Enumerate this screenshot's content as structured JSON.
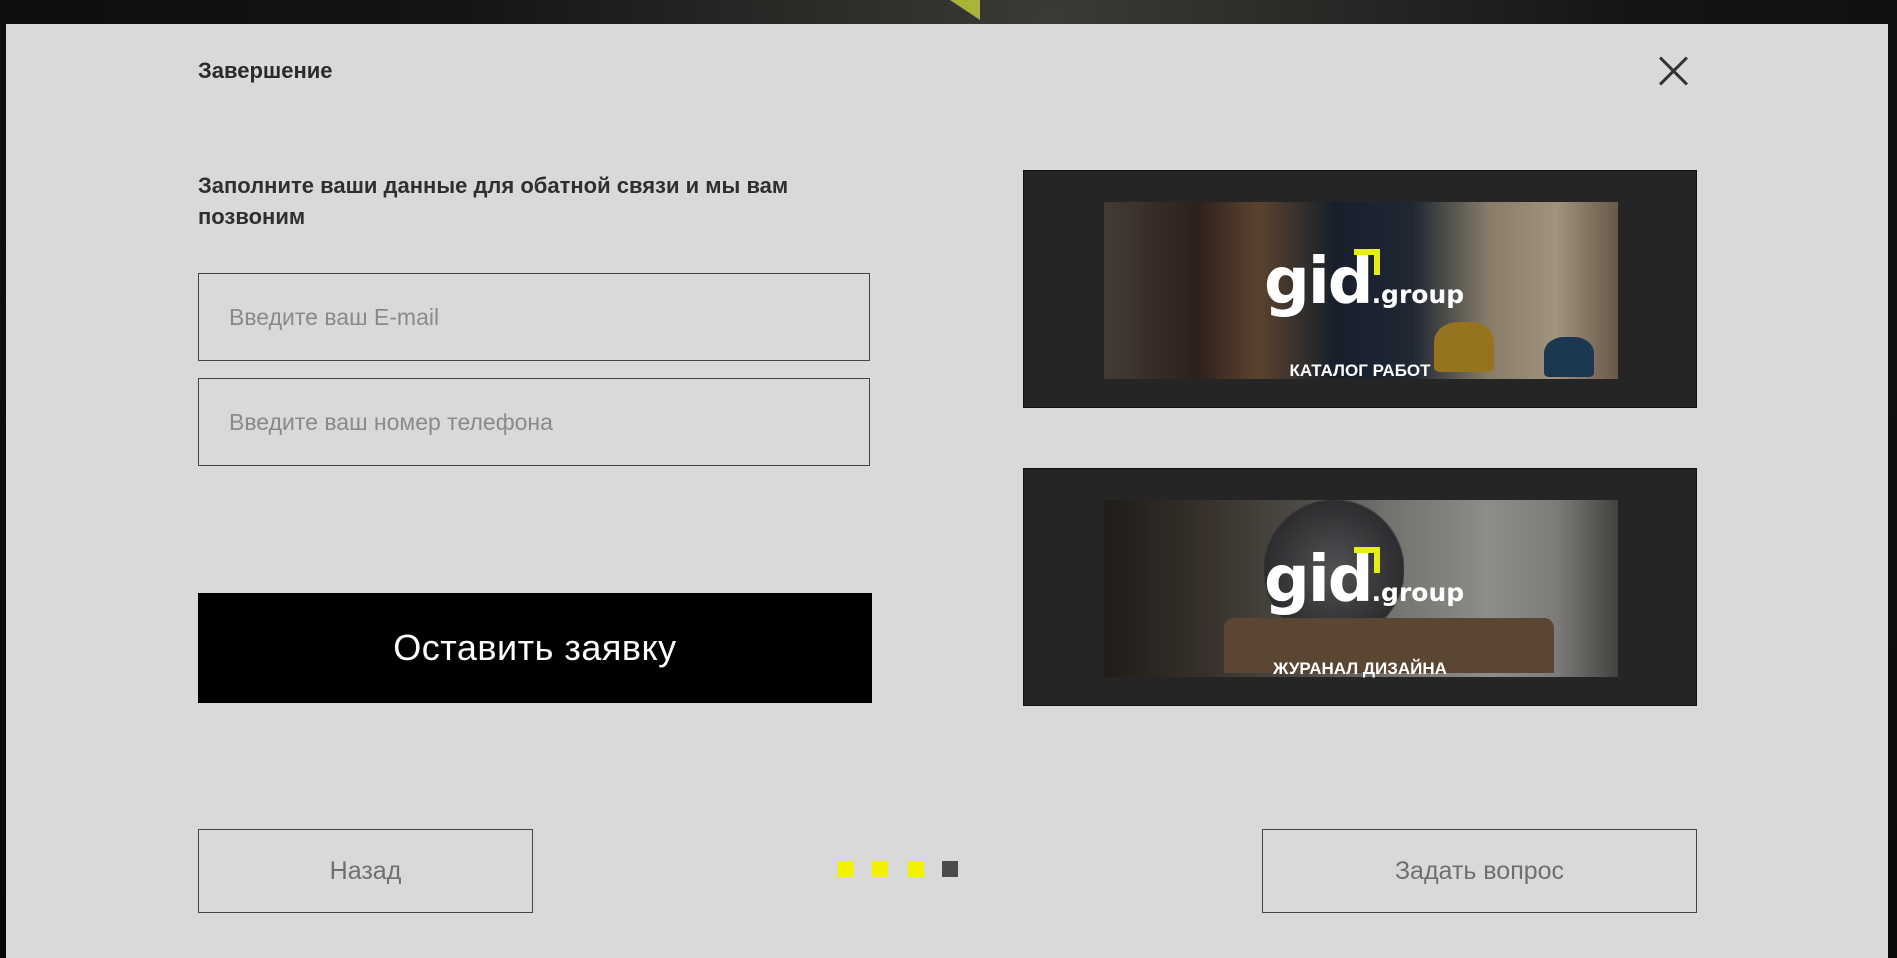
{
  "modal": {
    "title": "Завершение",
    "lead_text": "Заполните ваши данные для обатной связи и мы вам позвоним"
  },
  "form": {
    "email_placeholder": "Введите ваш E-mail",
    "email_value": "",
    "phone_placeholder": "Введите ваш номер телефона",
    "phone_value": "",
    "submit_label": "Оставить заявку"
  },
  "promos": [
    {
      "logo_main": "gid",
      "logo_sub": ".group",
      "caption": "КАТАЛОГ РАБОТ"
    },
    {
      "logo_main": "gid",
      "logo_sub": ".group",
      "caption": "ЖУРАНАЛ ДИЗАЙНА"
    }
  ],
  "navigation": {
    "back_label": "Назад",
    "ask_label": "Задать вопрос",
    "steps_total": 4,
    "current_step": 4
  },
  "colors": {
    "accent": "#f2f200",
    "modal_bg": "#d9d9d9",
    "button_bg": "#000000",
    "promo_bg": "#252525"
  },
  "icons": {
    "close": "close-icon"
  }
}
